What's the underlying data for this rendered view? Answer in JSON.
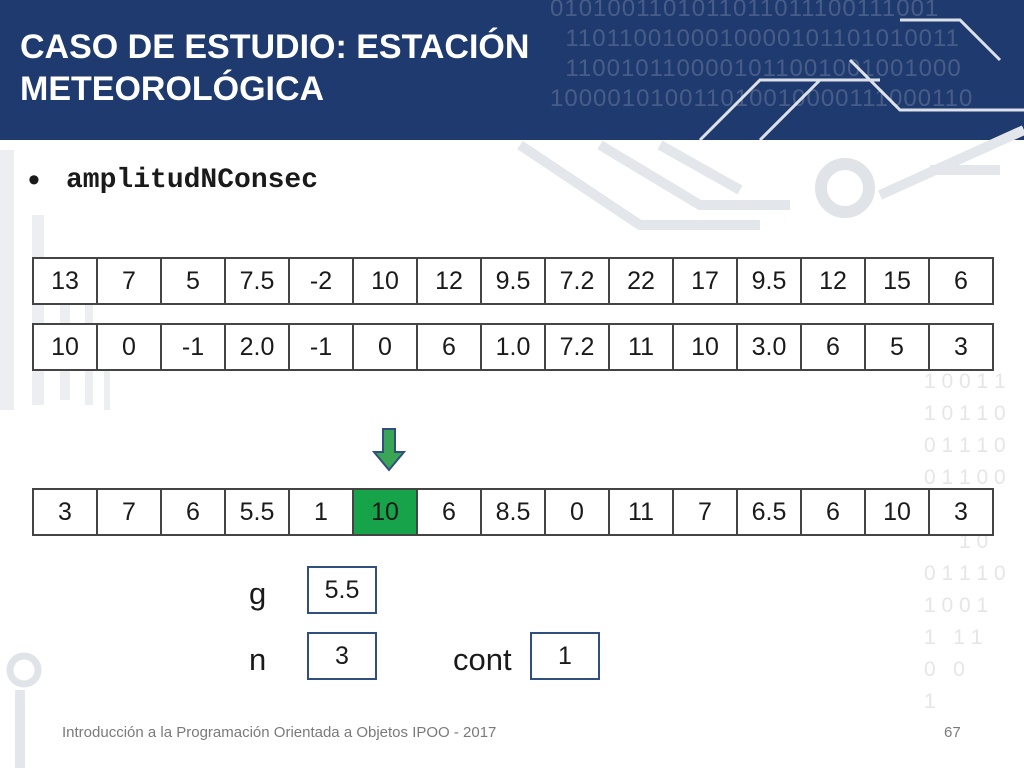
{
  "slide": {
    "title": "CASO DE ESTUDIO: ESTACIÓN METEOROLÓGICA",
    "bullet": "•",
    "keyword": "amplitudNConsec",
    "footer": "Introducción a la Programación Orientada a Objetos IPOO - 2017",
    "page_number": "67"
  },
  "decor": {
    "header_binary": "0101001101011011011100111001\n  1101100100010000101101010011\n  1100101100001011001001001000\n100001010011010010000111000110",
    "side_binary": "    1  0\n1 0 0 1 1\n1 0 1 1 0\n0 1 1 1 0\n0 1 1 0 0\n      0 1\n      1 0\n0 1 1 1 0\n1 0 0 1\n1   1 1\n0   0\n1"
  },
  "arrays": {
    "row1": [
      "13",
      "7",
      "5",
      "7.5",
      "-2",
      "10",
      "12",
      "9.5",
      "7.2",
      "22",
      "17",
      "9.5",
      "12",
      "15",
      "6"
    ],
    "row2": [
      "10",
      "0",
      "-1",
      "2.0",
      "-1",
      "0",
      "6",
      "1.0",
      "7.2",
      "11",
      "10",
      "3.0",
      "6",
      "5",
      "3"
    ],
    "row3": [
      "3",
      "7",
      "6",
      "5.5",
      "1",
      "10",
      "6",
      "8.5",
      "0",
      "11",
      "7",
      "6.5",
      "6",
      "10",
      "3"
    ],
    "highlight_index": 5,
    "highlight_color": "#16a34a"
  },
  "vars": {
    "g_label": "g",
    "g_value": "5.5",
    "n_label": "n",
    "n_value": "3",
    "cont_label": "cont",
    "cont_value": "1"
  },
  "colors": {
    "header_bg": "#1f3a6e",
    "arrow_fill": "#3aa655",
    "arrow_stroke": "#2f4f7f",
    "box_border": "#2f4f7f"
  }
}
